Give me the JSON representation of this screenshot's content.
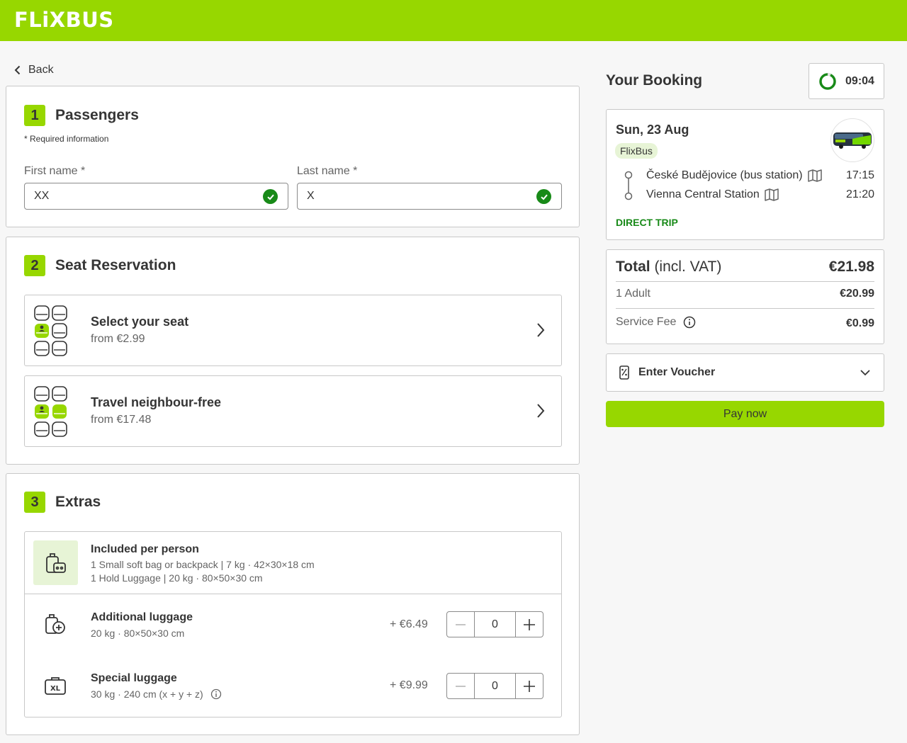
{
  "header": {
    "logo": "FLiXBUS"
  },
  "nav": {
    "back_label": "Back"
  },
  "passengers": {
    "number": "1",
    "title": "Passengers",
    "required_note": "* Required information",
    "first_name": {
      "label": "First name *",
      "value": "XX"
    },
    "last_name": {
      "label": "Last name *",
      "value": "X"
    }
  },
  "seats": {
    "number": "2",
    "title": "Seat Reservation",
    "options": [
      {
        "title": "Select your seat",
        "price": "from €2.99"
      },
      {
        "title": "Travel neighbour-free",
        "price": "from €17.48"
      }
    ]
  },
  "extras": {
    "number": "3",
    "title": "Extras",
    "included": {
      "title": "Included per person",
      "lines": [
        "1 Small soft bag or backpack | 7 kg · 42×30×18 cm",
        "1 Hold Luggage | 20 kg · 80×50×30 cm"
      ]
    },
    "items": [
      {
        "title": "Additional luggage",
        "detail": "20 kg · 80×50×30 cm",
        "price": "+ €6.49",
        "qty": "0"
      },
      {
        "title": "Special luggage",
        "detail": "30 kg · 240 cm (x + y + z)",
        "price": "+ €9.99",
        "qty": "0"
      }
    ]
  },
  "booking": {
    "title": "Your Booking",
    "timer": "09:04",
    "date": "Sun, 23 Aug",
    "brand": "FlixBus",
    "stops": [
      {
        "name": "České Budějovice (bus station)",
        "time": "17:15"
      },
      {
        "name": "Vienna Central Station",
        "time": "21:20"
      }
    ],
    "trip_type": "DIRECT TRIP"
  },
  "totals": {
    "label_bold": "Total",
    "label_rest": " (incl. VAT)",
    "total": "€21.98",
    "rows": [
      {
        "label": "1 Adult",
        "value": "€20.99"
      },
      {
        "label": "Service Fee",
        "value": "€0.99"
      }
    ]
  },
  "voucher": {
    "label": "Enter Voucher"
  },
  "pay": {
    "label": "Pay now"
  },
  "colors": {
    "brand": "#97d700",
    "success": "#188a18",
    "text": "#353535",
    "muted": "#646464",
    "border": "#c8c8c8"
  }
}
